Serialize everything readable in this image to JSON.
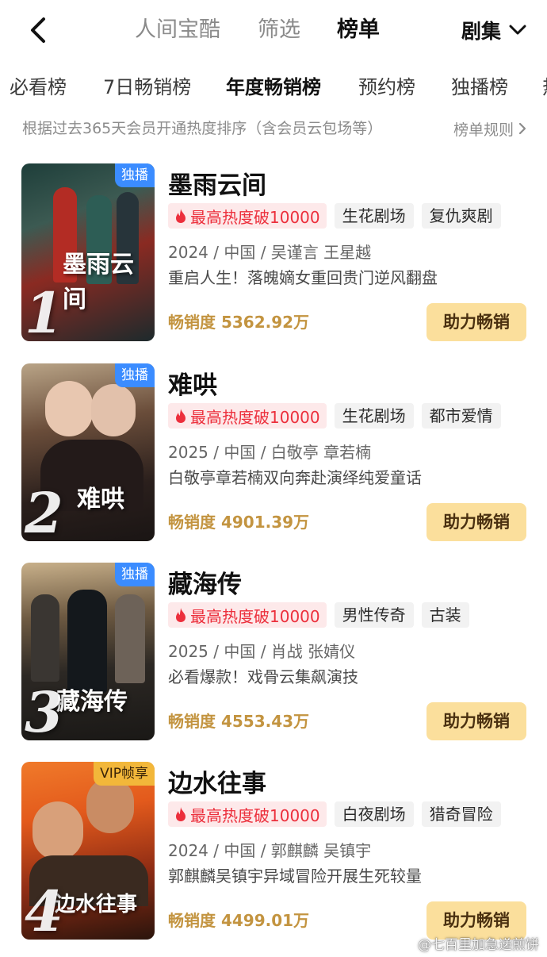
{
  "header": {
    "tabs": [
      {
        "label": "人间宝酷"
      },
      {
        "label": "筛选"
      },
      {
        "label": "榜单"
      }
    ],
    "category": "剧集"
  },
  "subtabs": [
    {
      "label": "必看榜"
    },
    {
      "label": "7日畅销榜"
    },
    {
      "label": "年度畅销榜"
    },
    {
      "label": "预约榜"
    },
    {
      "label": "独播榜"
    },
    {
      "label": "热"
    }
  ],
  "info": {
    "text": "根据过去365天会员开通热度排序（含会员云包场等）",
    "rules": "榜单规则"
  },
  "items": [
    {
      "rank": "1",
      "badge": "独播",
      "poster_title": "墨雨云间",
      "title": "墨雨云间",
      "heat": "最高热度破10000",
      "tags": [
        "生花剧场",
        "复仇爽剧"
      ],
      "meta": "2024 / 中国 / 吴谨言 王星越",
      "desc": "重启人生！落魄嫡女重回贵门逆风翻盘",
      "sales": "畅销度 5362.92万",
      "button": "助力畅销"
    },
    {
      "rank": "2",
      "badge": "独播",
      "poster_title": "难哄",
      "title": "难哄",
      "heat": "最高热度破10000",
      "tags": [
        "生花剧场",
        "都市爱情"
      ],
      "meta": "2025 / 中国 / 白敬亭 章若楠",
      "desc": "白敬亭章若楠双向奔赴演绎纯爱童话",
      "sales": "畅销度 4901.39万",
      "button": "助力畅销"
    },
    {
      "rank": "3",
      "badge": "独播",
      "poster_title": "藏海传",
      "title": "藏海传",
      "heat": "最高热度破10000",
      "tags": [
        "男性传奇",
        "古装"
      ],
      "meta": "2025 / 中国 / 肖战 张婧仪",
      "desc": "必看爆款！戏骨云集飙演技",
      "sales": "畅销度 4553.43万",
      "button": "助力畅销"
    },
    {
      "rank": "4",
      "badge": "VIP帧享",
      "poster_title": "边水往事",
      "title": "边水往事",
      "heat": "最高热度破10000",
      "tags": [
        "白夜剧场",
        "猎奇冒险"
      ],
      "meta": "2024 / 中国 / 郭麒麟 吴镇宇",
      "desc": "郭麒麟吴镇宇异域冒险开展生死较量",
      "sales": "畅销度 4499.01万",
      "button": "助力畅销"
    }
  ],
  "watermark": "@七百里加急递煎饼",
  "colors": {
    "accent_gold": "#c39440",
    "button_bg": "#fbdf9c",
    "heat_red": "#ec2f3c",
    "badge_blue": "#3b8cff",
    "badge_vip": "#f2b73a"
  }
}
